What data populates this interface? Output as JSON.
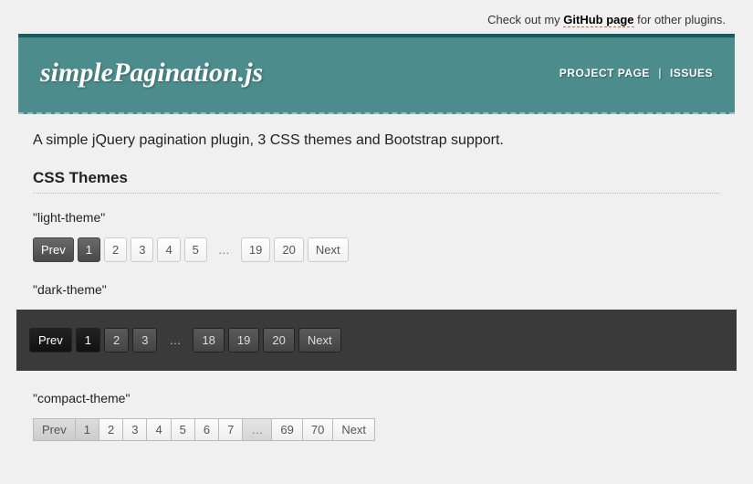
{
  "top_notice": {
    "pre": "Check out my ",
    "link": "GitHub page",
    "post": " for other plugins."
  },
  "header": {
    "logo": "simplePagination.js",
    "nav": {
      "project": "PROJECT PAGE",
      "issues": "ISSUES"
    }
  },
  "description": "A simple jQuery pagination plugin, 3 CSS themes and Bootstrap support.",
  "section_title": "CSS Themes",
  "themes": {
    "light": {
      "label": "\"light-theme\"",
      "items": [
        "Prev",
        "1",
        "2",
        "3",
        "4",
        "5",
        "…",
        "19",
        "20",
        "Next"
      ],
      "active_index": 1,
      "prev_index": 0,
      "ellipsis_indexes": [
        6
      ]
    },
    "dark": {
      "label": "\"dark-theme\"",
      "items": [
        "Prev",
        "1",
        "2",
        "3",
        "…",
        "18",
        "19",
        "20",
        "Next"
      ],
      "active_index": 1,
      "prev_index": 0,
      "ellipsis_indexes": [
        4
      ]
    },
    "compact": {
      "label": "\"compact-theme\"",
      "items": [
        "Prev",
        "1",
        "2",
        "3",
        "4",
        "5",
        "6",
        "7",
        "…",
        "69",
        "70",
        "Next"
      ],
      "active_index": 1,
      "prev_index": 0,
      "ellipsis_indexes": [
        8
      ]
    }
  }
}
